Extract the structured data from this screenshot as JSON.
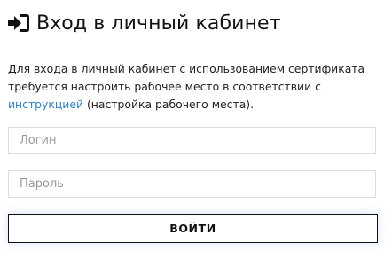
{
  "header": {
    "icon": "sign-in-icon",
    "title": "Вход в личный кабинет"
  },
  "description": {
    "text_before_link": "Для входа в личный кабинет с использованием сертификата требуется настроить рабочее место в соответствии с ",
    "link_text": "инструкцией",
    "text_after_link": " (настройка рабочего места)."
  },
  "form": {
    "login_placeholder": "Логин",
    "login_value": "",
    "password_placeholder": "Пароль",
    "password_value": "",
    "submit_label": "ВОЙТИ"
  },
  "colors": {
    "link": "#2f7fc0",
    "text": "#222222",
    "field_border": "#dedede",
    "button_border": "#111111"
  }
}
